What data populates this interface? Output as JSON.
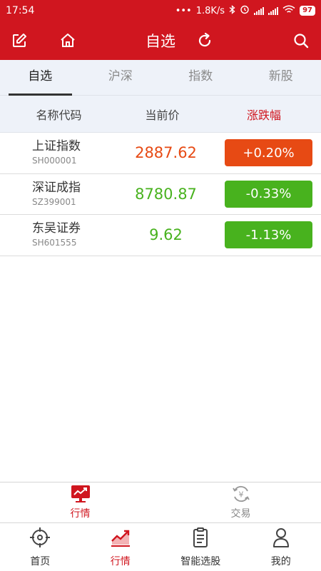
{
  "status": {
    "time": "17:54",
    "net_speed": "1.8K/s",
    "battery": "97"
  },
  "header": {
    "title": "自选"
  },
  "tabs": [
    {
      "label": "自选",
      "active": true
    },
    {
      "label": "沪深",
      "active": false
    },
    {
      "label": "指数",
      "active": false
    },
    {
      "label": "新股",
      "active": false
    }
  ],
  "columns": {
    "name": "名称代码",
    "price": "当前价",
    "change": "涨跌幅"
  },
  "stocks": [
    {
      "name": "上证指数",
      "code": "SH000001",
      "price": "2887.62",
      "change": "+0.20%",
      "color": "#e74a14"
    },
    {
      "name": "深证成指",
      "code": "SZ399001",
      "price": "8780.87",
      "change": "-0.33%",
      "color": "#48b21e"
    },
    {
      "name": "东吴证券",
      "code": "SH601555",
      "price": "9.62",
      "change": "-1.13%",
      "color": "#48b21e"
    }
  ],
  "subnav": [
    {
      "label": "行情",
      "icon": "chart-monitor-icon",
      "active": true
    },
    {
      "label": "交易",
      "icon": "yuan-exchange-icon",
      "active": false
    }
  ],
  "bottomnav": [
    {
      "label": "首页",
      "icon": "target-icon",
      "active": false
    },
    {
      "label": "行情",
      "icon": "trend-chart-icon",
      "active": true
    },
    {
      "label": "智能选股",
      "icon": "clipboard-icon",
      "active": false
    },
    {
      "label": "我的",
      "icon": "user-icon",
      "active": false
    }
  ],
  "colors": {
    "brand_red": "#d0161f",
    "up": "#e74a14",
    "down": "#48b21e"
  }
}
